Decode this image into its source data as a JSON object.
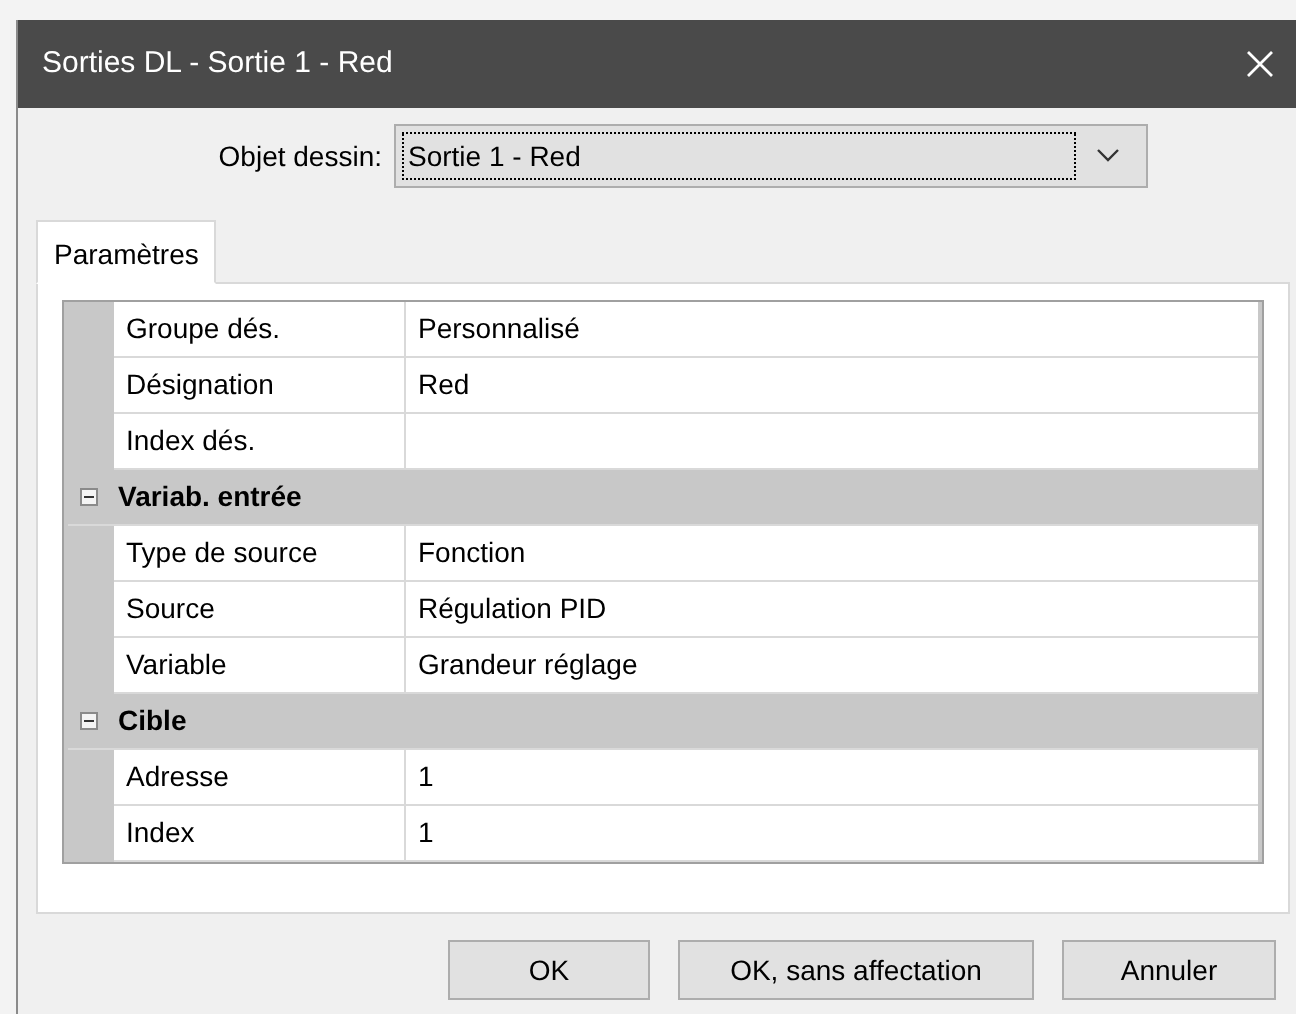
{
  "window": {
    "title": "Sorties DL - Sortie 1 - Red"
  },
  "object_field": {
    "label": "Objet dessin:",
    "value": "Sortie 1 - Red"
  },
  "tabs": [
    {
      "label": "Paramètres",
      "selected": true
    }
  ],
  "properties": {
    "sections": [
      {
        "rows": [
          {
            "name": "Groupe dés.",
            "value": "Personnalisé"
          },
          {
            "name": "Désignation",
            "value": "Red"
          },
          {
            "name": "Index dés."
          }
        ]
      },
      {
        "title": "Variab. entrée",
        "expanded": true,
        "rows": [
          {
            "name": "Type de source",
            "value": "Fonction"
          },
          {
            "name": "Source",
            "value": "Régulation PID"
          },
          {
            "name": "Variable",
            "value": "Grandeur réglage"
          }
        ]
      },
      {
        "title": "Cible",
        "expanded": true,
        "rows": [
          {
            "name": "Adresse",
            "value": "1"
          },
          {
            "name": "Index",
            "value": "1"
          }
        ]
      }
    ]
  },
  "buttons": [
    "OK",
    "OK, sans affectation",
    "Annuler"
  ]
}
